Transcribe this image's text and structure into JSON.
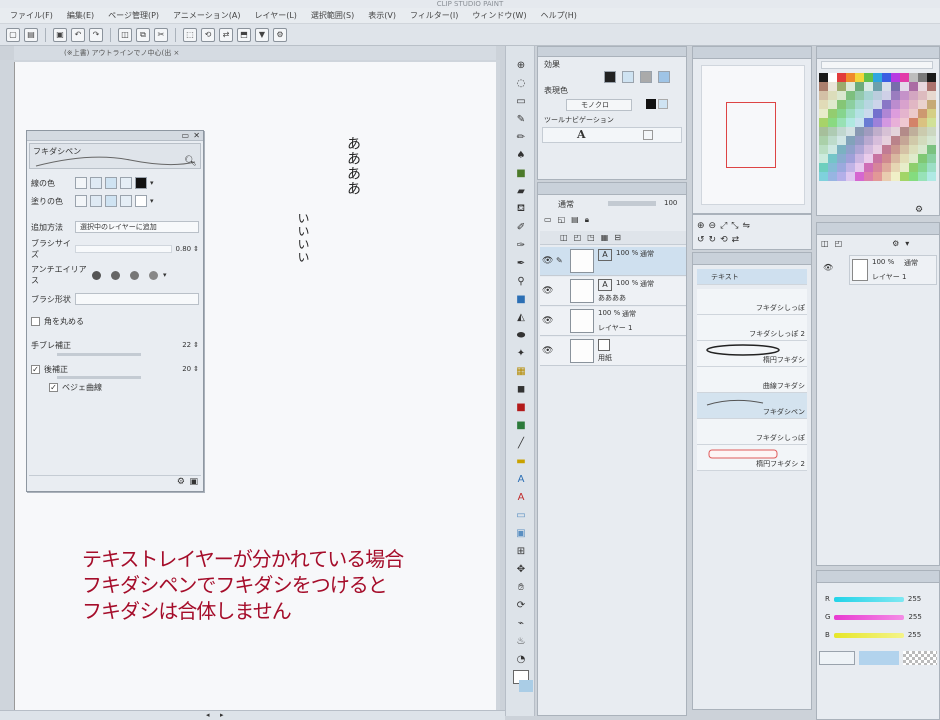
{
  "app": {
    "title": "CLIP STUDIO PAINT"
  },
  "menu": [
    "ファイル(F)",
    "編集(E)",
    "ページ管理(P)",
    "アニメーション(A)",
    "レイヤー(L)",
    "選択範囲(S)",
    "表示(V)",
    "フィルター(I)",
    "ウィンドウ(W)",
    "ヘルプ(H)"
  ],
  "doc_tab": "(※上書) アウトラインでノ中心(出 ×",
  "canvas": {
    "text1": "ああああ",
    "text2": "いいいい"
  },
  "tool_property": {
    "tool_name": "フキダシペン",
    "main_color_label": "線の色",
    "fill_color_label": "塗りの色",
    "add_method_label": "追加方法",
    "add_method_value": "選択中のレイヤーに追加",
    "brush_size_label": "ブラシサイズ",
    "brush_size_value": "0.80",
    "antialias_label": "アンチエイリアス",
    "brush_shape_label": "ブラシ形状",
    "round_corners_label": "角を丸める",
    "stabilization_label": "手ブレ補正",
    "stabilization_value": "22",
    "post_correction_label": "後補正",
    "post_correction_value": "20",
    "bezier_label": "ベジェ曲線"
  },
  "caption": {
    "line1": "テキストレイヤーが分かれている場合",
    "line2": "フキダシペンでフキダシをつけると",
    "line3": "フキダシは合体しません"
  },
  "tool_settings_panel": {
    "effect_label": "効果",
    "expression_color_label": "表現色",
    "expression_color_value": "モノクロ",
    "navigation_label": "ツールナビゲーション"
  },
  "layer_panel": {
    "blend_mode": "通常",
    "opacity": "100",
    "layers": [
      {
        "percent": "100 %",
        "mode": "通常",
        "name": ""
      },
      {
        "percent": "100 %",
        "mode": "通常",
        "name": "ああああ"
      },
      {
        "percent": "100 %",
        "mode": "通常",
        "name": "レイヤー 1"
      },
      {
        "percent": "",
        "mode": "",
        "name": "用紙"
      }
    ]
  },
  "material_panel": {
    "items": [
      "テキスト",
      "フキダシしっぽ",
      "フキダシしっぽ 2",
      "楕円フキダシ",
      "曲線フキダシ",
      "フキダシペン",
      "フキダシしっぽ",
      "楕円フキダシ 2"
    ]
  },
  "layer_property_panel": {
    "opacity": "100 %",
    "mode": "通常",
    "name": "レイヤー 1"
  },
  "color_slider": {
    "r_label": "R",
    "g_label": "G",
    "b_label": "B",
    "r_value": "255",
    "g_value": "255",
    "b_value": "255"
  }
}
